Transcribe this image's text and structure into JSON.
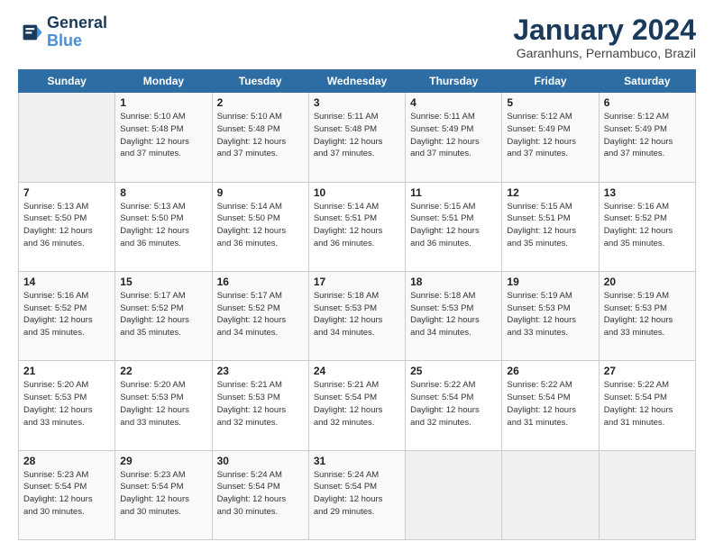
{
  "logo": {
    "line1": "General",
    "line2": "Blue"
  },
  "title": "January 2024",
  "subtitle": "Garanhuns, Pernambuco, Brazil",
  "days_header": [
    "Sunday",
    "Monday",
    "Tuesday",
    "Wednesday",
    "Thursday",
    "Friday",
    "Saturday"
  ],
  "weeks": [
    [
      {
        "day": "",
        "info": ""
      },
      {
        "day": "1",
        "info": "Sunrise: 5:10 AM\nSunset: 5:48 PM\nDaylight: 12 hours\nand 37 minutes."
      },
      {
        "day": "2",
        "info": "Sunrise: 5:10 AM\nSunset: 5:48 PM\nDaylight: 12 hours\nand 37 minutes."
      },
      {
        "day": "3",
        "info": "Sunrise: 5:11 AM\nSunset: 5:48 PM\nDaylight: 12 hours\nand 37 minutes."
      },
      {
        "day": "4",
        "info": "Sunrise: 5:11 AM\nSunset: 5:49 PM\nDaylight: 12 hours\nand 37 minutes."
      },
      {
        "day": "5",
        "info": "Sunrise: 5:12 AM\nSunset: 5:49 PM\nDaylight: 12 hours\nand 37 minutes."
      },
      {
        "day": "6",
        "info": "Sunrise: 5:12 AM\nSunset: 5:49 PM\nDaylight: 12 hours\nand 37 minutes."
      }
    ],
    [
      {
        "day": "7",
        "info": "Sunrise: 5:13 AM\nSunset: 5:50 PM\nDaylight: 12 hours\nand 36 minutes."
      },
      {
        "day": "8",
        "info": "Sunrise: 5:13 AM\nSunset: 5:50 PM\nDaylight: 12 hours\nand 36 minutes."
      },
      {
        "day": "9",
        "info": "Sunrise: 5:14 AM\nSunset: 5:50 PM\nDaylight: 12 hours\nand 36 minutes."
      },
      {
        "day": "10",
        "info": "Sunrise: 5:14 AM\nSunset: 5:51 PM\nDaylight: 12 hours\nand 36 minutes."
      },
      {
        "day": "11",
        "info": "Sunrise: 5:15 AM\nSunset: 5:51 PM\nDaylight: 12 hours\nand 36 minutes."
      },
      {
        "day": "12",
        "info": "Sunrise: 5:15 AM\nSunset: 5:51 PM\nDaylight: 12 hours\nand 35 minutes."
      },
      {
        "day": "13",
        "info": "Sunrise: 5:16 AM\nSunset: 5:52 PM\nDaylight: 12 hours\nand 35 minutes."
      }
    ],
    [
      {
        "day": "14",
        "info": "Sunrise: 5:16 AM\nSunset: 5:52 PM\nDaylight: 12 hours\nand 35 minutes."
      },
      {
        "day": "15",
        "info": "Sunrise: 5:17 AM\nSunset: 5:52 PM\nDaylight: 12 hours\nand 35 minutes."
      },
      {
        "day": "16",
        "info": "Sunrise: 5:17 AM\nSunset: 5:52 PM\nDaylight: 12 hours\nand 34 minutes."
      },
      {
        "day": "17",
        "info": "Sunrise: 5:18 AM\nSunset: 5:53 PM\nDaylight: 12 hours\nand 34 minutes."
      },
      {
        "day": "18",
        "info": "Sunrise: 5:18 AM\nSunset: 5:53 PM\nDaylight: 12 hours\nand 34 minutes."
      },
      {
        "day": "19",
        "info": "Sunrise: 5:19 AM\nSunset: 5:53 PM\nDaylight: 12 hours\nand 33 minutes."
      },
      {
        "day": "20",
        "info": "Sunrise: 5:19 AM\nSunset: 5:53 PM\nDaylight: 12 hours\nand 33 minutes."
      }
    ],
    [
      {
        "day": "21",
        "info": "Sunrise: 5:20 AM\nSunset: 5:53 PM\nDaylight: 12 hours\nand 33 minutes."
      },
      {
        "day": "22",
        "info": "Sunrise: 5:20 AM\nSunset: 5:53 PM\nDaylight: 12 hours\nand 33 minutes."
      },
      {
        "day": "23",
        "info": "Sunrise: 5:21 AM\nSunset: 5:53 PM\nDaylight: 12 hours\nand 32 minutes."
      },
      {
        "day": "24",
        "info": "Sunrise: 5:21 AM\nSunset: 5:54 PM\nDaylight: 12 hours\nand 32 minutes."
      },
      {
        "day": "25",
        "info": "Sunrise: 5:22 AM\nSunset: 5:54 PM\nDaylight: 12 hours\nand 32 minutes."
      },
      {
        "day": "26",
        "info": "Sunrise: 5:22 AM\nSunset: 5:54 PM\nDaylight: 12 hours\nand 31 minutes."
      },
      {
        "day": "27",
        "info": "Sunrise: 5:22 AM\nSunset: 5:54 PM\nDaylight: 12 hours\nand 31 minutes."
      }
    ],
    [
      {
        "day": "28",
        "info": "Sunrise: 5:23 AM\nSunset: 5:54 PM\nDaylight: 12 hours\nand 30 minutes."
      },
      {
        "day": "29",
        "info": "Sunrise: 5:23 AM\nSunset: 5:54 PM\nDaylight: 12 hours\nand 30 minutes."
      },
      {
        "day": "30",
        "info": "Sunrise: 5:24 AM\nSunset: 5:54 PM\nDaylight: 12 hours\nand 30 minutes."
      },
      {
        "day": "31",
        "info": "Sunrise: 5:24 AM\nSunset: 5:54 PM\nDaylight: 12 hours\nand 29 minutes."
      },
      {
        "day": "",
        "info": ""
      },
      {
        "day": "",
        "info": ""
      },
      {
        "day": "",
        "info": ""
      }
    ]
  ]
}
